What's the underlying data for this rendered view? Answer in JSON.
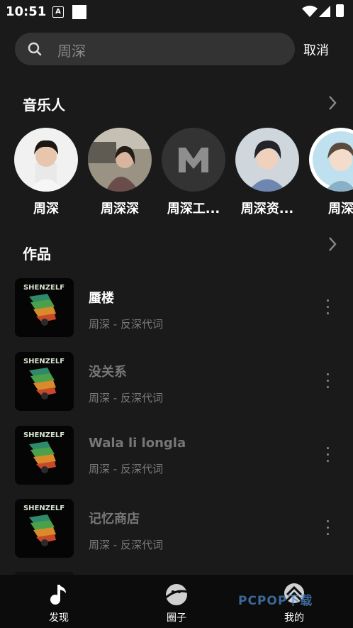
{
  "status_bar": {
    "time": "10:51",
    "a_icon": "A"
  },
  "search": {
    "placeholder": "周深",
    "cancel": "取消"
  },
  "sections": {
    "artists_title": "音乐人",
    "works_title": "作品"
  },
  "artists": [
    {
      "name": "周深"
    },
    {
      "name": "周深深"
    },
    {
      "name": "周深工..."
    },
    {
      "name": "周深资..."
    },
    {
      "name": "周深"
    }
  ],
  "tracks": [
    {
      "title": "蜃楼",
      "subtitle": "周深 - 反深代词"
    },
    {
      "title": "没关系",
      "subtitle": "周深 - 反深代词"
    },
    {
      "title": "Wala li longla",
      "subtitle": "周深 - 反深代词"
    },
    {
      "title": "记忆商店",
      "subtitle": "周深 - 反深代词"
    }
  ],
  "album_cover_text": "SHENZELF",
  "tabs": [
    {
      "label": "发现",
      "icon": "music-note-icon"
    },
    {
      "label": "圈子",
      "icon": "planet-icon"
    },
    {
      "label": "我的",
      "icon": "profile-icon"
    }
  ],
  "watermark": "PCPOP下载",
  "colors": {
    "background": "#1a1a1a",
    "search_bg": "#333333",
    "tab_bar_bg": "#0c0c0c",
    "dim_text": "#7a7a7a"
  }
}
